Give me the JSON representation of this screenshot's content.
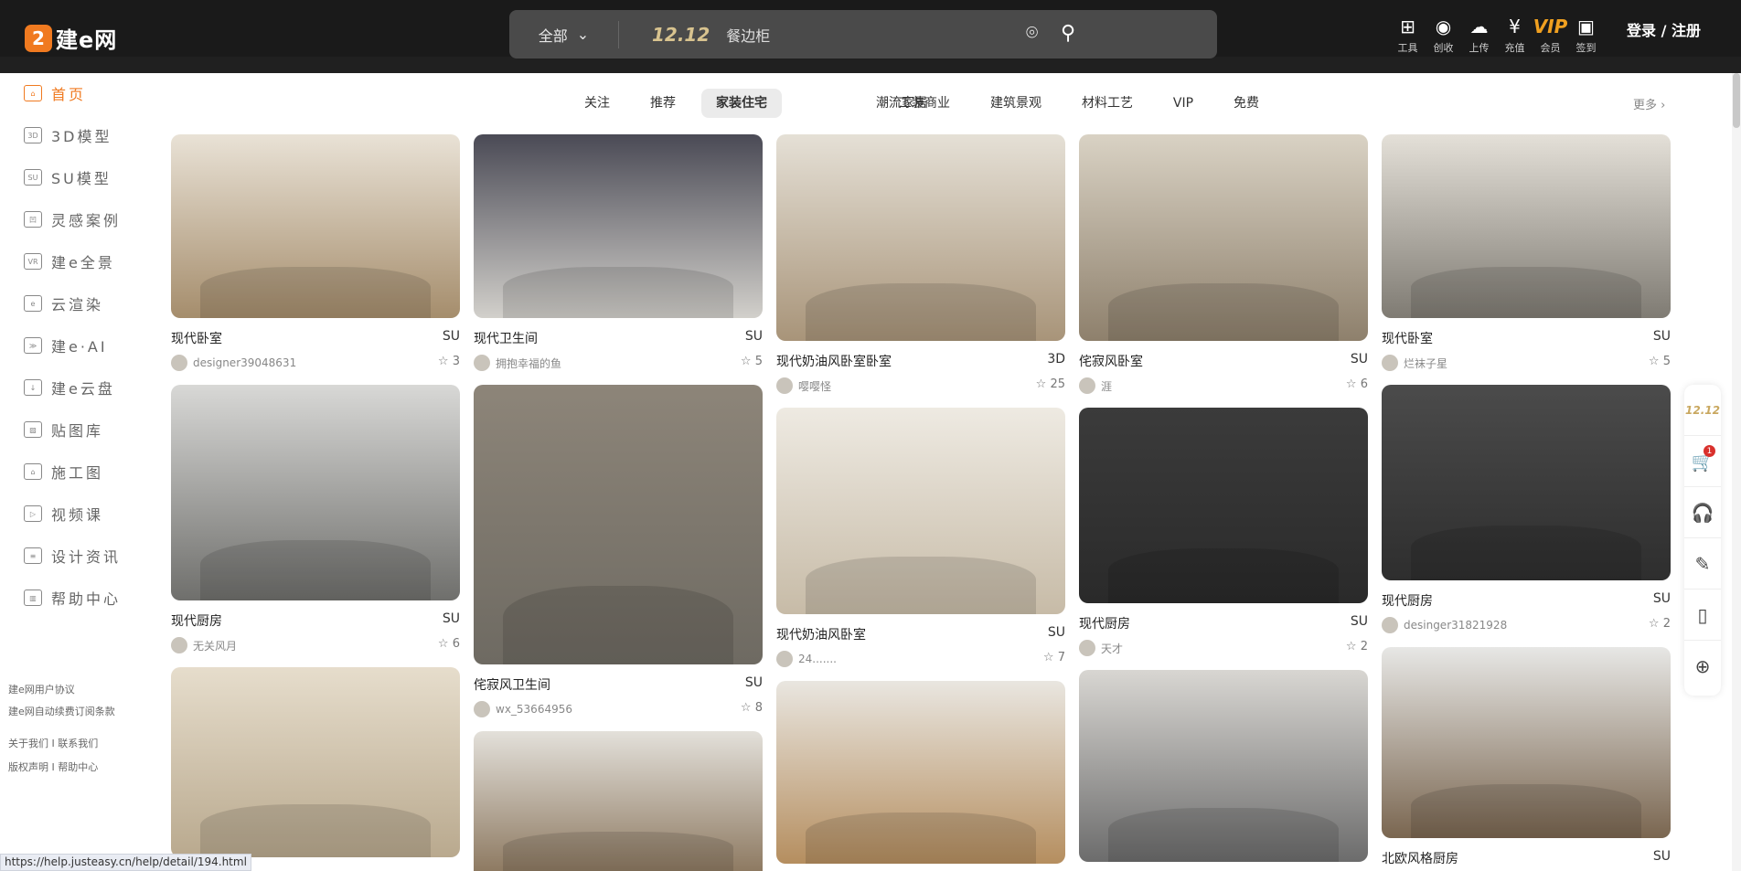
{
  "header": {
    "logo_mark": "2",
    "logo_text": "建e网",
    "search": {
      "category": "全部",
      "promo": "12.12",
      "keyword": "餐边柜"
    },
    "icons": [
      {
        "label": "工具",
        "glyph": "⊞",
        "icon": "grid-icon"
      },
      {
        "label": "创收",
        "glyph": "◉",
        "icon": "lightbulb-icon"
      },
      {
        "label": "上传",
        "glyph": "☁",
        "icon": "upload-icon"
      },
      {
        "label": "充值",
        "glyph": "¥",
        "icon": "yen-icon"
      },
      {
        "label": "会员",
        "glyph": "VIP",
        "icon": "vip-icon"
      },
      {
        "label": "签到",
        "glyph": "▣",
        "icon": "calendar-check-icon"
      }
    ],
    "login": "登录 / 注册"
  },
  "sidebar": {
    "items": [
      {
        "label": "首页",
        "icon": "home-icon",
        "glyph": "⌂",
        "active": true
      },
      {
        "label": "3D模型",
        "icon": "3d-model-icon",
        "glyph": "3D"
      },
      {
        "label": "SU模型",
        "icon": "su-model-icon",
        "glyph": "SU"
      },
      {
        "label": "灵感案例",
        "icon": "inspiration-icon",
        "glyph": "凹"
      },
      {
        "label": "建e全景",
        "icon": "vr-icon",
        "glyph": "VR"
      },
      {
        "label": "云渲染",
        "icon": "cloud-render-icon",
        "glyph": "e"
      },
      {
        "label": "建e·AI",
        "icon": "ai-icon",
        "glyph": "≫"
      },
      {
        "label": "建e云盘",
        "icon": "cloud-disk-icon",
        "glyph": "↓"
      },
      {
        "label": "贴图库",
        "icon": "texture-icon",
        "glyph": "▨"
      },
      {
        "label": "施工图",
        "icon": "blueprint-icon",
        "glyph": "⌂"
      },
      {
        "label": "视频课",
        "icon": "video-icon",
        "glyph": "▷"
      },
      {
        "label": "设计资讯",
        "icon": "news-icon",
        "glyph": "≡"
      },
      {
        "label": "帮助中心",
        "icon": "help-book-icon",
        "glyph": "▥"
      }
    ],
    "footer": [
      "建e网用户协议",
      "建e网自动续费订阅条款",
      "关于我们  I 联系我们",
      "版权声明  I 帮助中心"
    ]
  },
  "tabs": [
    {
      "label": "关注"
    },
    {
      "label": "推荐"
    },
    {
      "label": "家装住宅",
      "active": true
    },
    {
      "label": "潮流家居"
    },
    {
      "label": "工装商业"
    },
    {
      "label": "建筑景观"
    },
    {
      "label": "材料工艺"
    },
    {
      "label": "VIP"
    },
    {
      "label": "免费"
    }
  ],
  "more": "更多 ›",
  "columns": [
    [
      {
        "title": "现代卧室",
        "type": "SU",
        "user": "designer39048631",
        "favs": "3",
        "colors": [
          "#e9e2d6",
          "#a58d6c"
        ],
        "h": 201
      },
      {
        "title": "现代厨房",
        "type": "SU",
        "user": "无关风月",
        "favs": "6",
        "colors": [
          "#d8d8d6",
          "#6f6f6c"
        ],
        "h": 236
      },
      {
        "colors": [
          "#e6ddcc",
          "#b9a98e"
        ],
        "h": 208
      }
    ],
    [
      {
        "title": "现代卫生间",
        "type": "SU",
        "user": "拥抱幸福的鱼",
        "favs": "5",
        "colors": [
          "#4a4a55",
          "#d2d0cb"
        ],
        "h": 201
      },
      {
        "title": "侘寂风卫生间",
        "type": "SU",
        "user": "wx_53664956",
        "favs": "8",
        "colors": [
          "#8d8579",
          "#6e6a62"
        ],
        "h": 306
      },
      {
        "colors": [
          "#e3e0da",
          "#8e7a62"
        ],
        "h": 200
      }
    ],
    [
      {
        "title": "现代奶油风卧室卧室",
        "type": "3D",
        "user": "嘤嘤怪",
        "favs": "25",
        "colors": [
          "#e5e0d6",
          "#a89479"
        ],
        "h": 226
      },
      {
        "title": "现代奶油风卧室",
        "type": "SU",
        "user": "24.......",
        "favs": "7",
        "colors": [
          "#eeeae2",
          "#c7bba7"
        ],
        "h": 226
      },
      {
        "colors": [
          "#e9e6e0",
          "#b58e5f"
        ],
        "h": 200
      }
    ],
    [
      {
        "title": "侘寂风卧室",
        "type": "SU",
        "user": "涯",
        "favs": "6",
        "colors": [
          "#d9d2c4",
          "#8e806c"
        ],
        "h": 226
      },
      {
        "title": "现代厨房",
        "type": "SU",
        "user": "天才",
        "favs": "2",
        "colors": [
          "#3b3b3b",
          "#2a2a2a"
        ],
        "h": 214
      },
      {
        "colors": [
          "#d8d6d2",
          "#6c6c6c"
        ],
        "h": 210
      }
    ],
    [
      {
        "title": "现代卧室",
        "type": "SU",
        "user": "烂袜子星",
        "favs": "5",
        "colors": [
          "#e4e0d8",
          "#7f7b73"
        ],
        "h": 201
      },
      {
        "title": "现代厨房",
        "type": "SU",
        "user": "desinger31821928",
        "favs": "2",
        "colors": [
          "#4b4b4b",
          "#2e2e2e"
        ],
        "h": 214
      },
      {
        "title": "北欧风格厨房",
        "type": "SU",
        "colors": [
          "#e7e7e5",
          "#7a6650"
        ],
        "h": 209
      }
    ]
  ],
  "float_toolbar": {
    "promo": "12.12",
    "cart_badge": "1",
    "items": [
      {
        "icon": "cart-icon",
        "glyph": "🛒"
      },
      {
        "icon": "headset-icon",
        "glyph": "🎧"
      },
      {
        "icon": "edit-note-icon",
        "glyph": "✎"
      },
      {
        "icon": "mobile-icon",
        "glyph": "▯"
      },
      {
        "icon": "back-to-top-icon",
        "glyph": "⊕"
      }
    ]
  },
  "status_url": "https://help.justeasy.cn/help/detail/194.html"
}
